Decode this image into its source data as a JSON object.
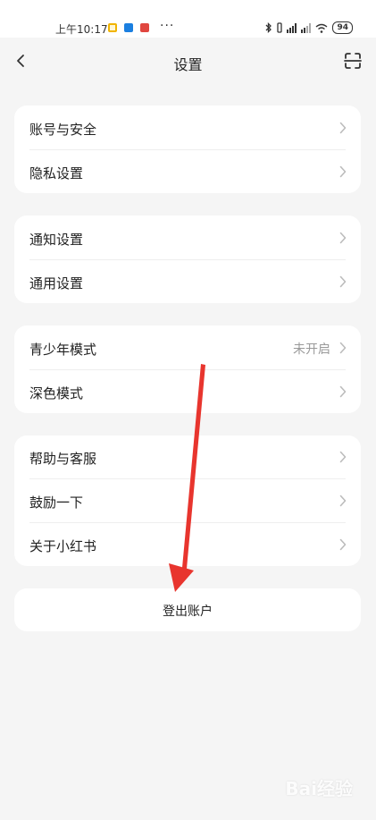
{
  "status_bar": {
    "time": "上午10:17",
    "dots": "···",
    "battery": "94"
  },
  "header": {
    "title": "设置",
    "back_icon": "chevron-left-icon",
    "scan_icon": "scan-icon"
  },
  "groups": [
    {
      "items": [
        {
          "label": "账号与安全"
        },
        {
          "label": "隐私设置"
        }
      ]
    },
    {
      "items": [
        {
          "label": "通知设置"
        },
        {
          "label": "通用设置"
        }
      ]
    },
    {
      "items": [
        {
          "label": "青少年模式",
          "value": "未开启"
        },
        {
          "label": "深色模式"
        }
      ]
    },
    {
      "items": [
        {
          "label": "帮助与客服"
        },
        {
          "label": "鼓励一下"
        },
        {
          "label": "关于小红书"
        }
      ]
    }
  ],
  "logout": {
    "label": "登出账户"
  },
  "watermark": "Bai经验",
  "colors": {
    "background": "#f5f5f5",
    "card": "#ffffff",
    "arrow": "#e8352e",
    "secondary_text": "#999999"
  }
}
